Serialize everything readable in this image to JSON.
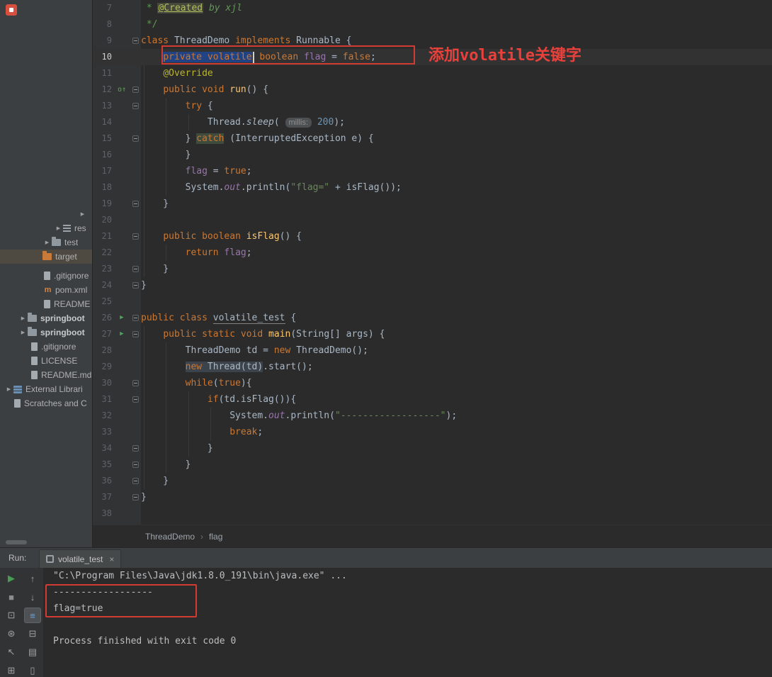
{
  "project_tree": {
    "items": [
      {
        "indent": 110,
        "arrow": true,
        "icon": "",
        "label": "",
        "bold": false,
        "selected": false
      },
      {
        "indent": 76,
        "arrow": true,
        "icon": "list",
        "label": "res",
        "bold": false,
        "selected": false
      },
      {
        "indent": 60,
        "arrow": true,
        "icon": "folder",
        "label": "test",
        "bold": false,
        "selected": false
      },
      {
        "indent": 60,
        "arrow": false,
        "icon": "folder-ex",
        "label": "target",
        "bold": false,
        "selected": true
      },
      {
        "indent": 62,
        "arrow": false,
        "icon": "file",
        "label": ".gitignore",
        "bold": false,
        "selected": false
      },
      {
        "indent": 62,
        "arrow": false,
        "icon": "maven",
        "label": "pom.xml",
        "bold": false,
        "selected": false
      },
      {
        "indent": 62,
        "arrow": false,
        "icon": "file",
        "label": "README",
        "bold": false,
        "selected": false
      },
      {
        "indent": 26,
        "arrow": true,
        "icon": "folder",
        "label": "springboot",
        "bold": true,
        "selected": false
      },
      {
        "indent": 26,
        "arrow": true,
        "icon": "folder",
        "label": "springboot",
        "bold": true,
        "selected": false
      },
      {
        "indent": 44,
        "arrow": false,
        "icon": "file",
        "label": ".gitignore",
        "bold": false,
        "selected": false
      },
      {
        "indent": 44,
        "arrow": false,
        "icon": "file",
        "label": "LICENSE",
        "bold": false,
        "selected": false
      },
      {
        "indent": 44,
        "arrow": false,
        "icon": "file",
        "label": "README.md",
        "bold": false,
        "selected": false
      },
      {
        "indent": 6,
        "arrow": true,
        "icon": "lib",
        "label": "External Librari",
        "bold": false,
        "selected": false
      },
      {
        "indent": 20,
        "arrow": false,
        "icon": "file",
        "label": "Scratches and C",
        "bold": false,
        "selected": false
      }
    ]
  },
  "editor": {
    "annotation": "添加volatile关键字",
    "icons": {
      "override": "o↑",
      "run": "▶"
    },
    "breadcrumb": {
      "items": [
        "ThreadDemo",
        "flag"
      ],
      "separator": "›"
    },
    "lines": [
      {
        "n": 7,
        "tokens": [
          [
            " * ",
            "c"
          ],
          [
            "@Created",
            "tag"
          ],
          [
            " ",
            "c"
          ],
          [
            "by xjl",
            "ci"
          ]
        ]
      },
      {
        "n": 8,
        "tokens": [
          [
            " */",
            "c"
          ]
        ]
      },
      {
        "n": 9,
        "fold": true,
        "tokens": [
          [
            "class",
            "k"
          ],
          [
            " ThreadDemo ",
            "d"
          ],
          [
            "implements",
            "k"
          ],
          [
            " Runnable {",
            "d"
          ]
        ]
      },
      {
        "n": 10,
        "caret": true,
        "tokens": [
          [
            "    ",
            "d"
          ],
          [
            "private volatile",
            "ksel"
          ],
          [
            "",
            "cur"
          ],
          [
            " ",
            "d"
          ],
          [
            "boolean",
            "k"
          ],
          [
            " ",
            "d"
          ],
          [
            "flag",
            "f"
          ],
          [
            " = ",
            "d"
          ],
          [
            "false",
            "k"
          ],
          [
            ";",
            "d"
          ]
        ]
      },
      {
        "n": 11,
        "tokens": [
          [
            "    ",
            "d"
          ],
          [
            "@Override",
            "a"
          ]
        ]
      },
      {
        "n": 12,
        "fold": true,
        "marker": "override",
        "tokens": [
          [
            "    ",
            "d"
          ],
          [
            "public",
            "k"
          ],
          [
            " ",
            "d"
          ],
          [
            "void",
            "k"
          ],
          [
            " ",
            "d"
          ],
          [
            "run",
            "m"
          ],
          [
            "() {",
            "d"
          ]
        ]
      },
      {
        "n": 13,
        "fold": true,
        "tokens": [
          [
            "        ",
            "d"
          ],
          [
            "try",
            "k"
          ],
          [
            " {",
            "d"
          ]
        ]
      },
      {
        "n": 14,
        "tokens": [
          [
            "            Thread.",
            "d"
          ],
          [
            "sleep",
            "it"
          ],
          [
            "( ",
            "d"
          ],
          [
            "millis:",
            "hint"
          ],
          [
            " ",
            "d"
          ],
          [
            "200",
            "n"
          ],
          [
            ");",
            "d"
          ]
        ]
      },
      {
        "n": 15,
        "fold": true,
        "tokens": [
          [
            "        } ",
            "d"
          ],
          [
            "catch",
            "khl"
          ],
          [
            " (InterruptedException e) {",
            "d"
          ]
        ]
      },
      {
        "n": 16,
        "tokens": [
          [
            "        }",
            "d"
          ]
        ]
      },
      {
        "n": 17,
        "tokens": [
          [
            "        ",
            "d"
          ],
          [
            "flag",
            "f"
          ],
          [
            " = ",
            "d"
          ],
          [
            "true",
            "k"
          ],
          [
            ";",
            "d"
          ]
        ]
      },
      {
        "n": 18,
        "tokens": [
          [
            "        System.",
            "d"
          ],
          [
            "out",
            "fi"
          ],
          [
            ".println(",
            "d"
          ],
          [
            "\"flag=\"",
            "s"
          ],
          [
            " + isFlag());",
            "d"
          ]
        ]
      },
      {
        "n": 19,
        "fold": true,
        "tokens": [
          [
            "    }",
            "d"
          ]
        ]
      },
      {
        "n": 20,
        "tokens": []
      },
      {
        "n": 21,
        "fold": true,
        "tokens": [
          [
            "    ",
            "d"
          ],
          [
            "public",
            "k"
          ],
          [
            " ",
            "d"
          ],
          [
            "boolean",
            "k"
          ],
          [
            " ",
            "d"
          ],
          [
            "isFlag",
            "m"
          ],
          [
            "() {",
            "d"
          ]
        ]
      },
      {
        "n": 22,
        "tokens": [
          [
            "        ",
            "d"
          ],
          [
            "return",
            "k"
          ],
          [
            " ",
            "d"
          ],
          [
            "flag",
            "f"
          ],
          [
            ";",
            "d"
          ]
        ]
      },
      {
        "n": 23,
        "fold": true,
        "tokens": [
          [
            "    }",
            "d"
          ]
        ]
      },
      {
        "n": 24,
        "fold": true,
        "tokens": [
          [
            "}",
            "d"
          ]
        ]
      },
      {
        "n": 25,
        "tokens": []
      },
      {
        "n": 26,
        "fold": true,
        "marker": "run",
        "tokens": [
          [
            "public",
            "k"
          ],
          [
            " ",
            "d"
          ],
          [
            "class",
            "k"
          ],
          [
            " ",
            "d"
          ],
          [
            "volatile_test",
            "u"
          ],
          [
            " {",
            "d"
          ]
        ]
      },
      {
        "n": 27,
        "fold": true,
        "marker": "run",
        "tokens": [
          [
            "    ",
            "d"
          ],
          [
            "public",
            "k"
          ],
          [
            " ",
            "d"
          ],
          [
            "static",
            "k"
          ],
          [
            " ",
            "d"
          ],
          [
            "void",
            "k"
          ],
          [
            " ",
            "d"
          ],
          [
            "main",
            "m"
          ],
          [
            "(String[] args) {",
            "d"
          ]
        ]
      },
      {
        "n": 28,
        "tokens": [
          [
            "        ThreadDemo td = ",
            "d"
          ],
          [
            "new",
            "k"
          ],
          [
            " ThreadDemo();",
            "d"
          ]
        ]
      },
      {
        "n": 29,
        "tokens": [
          [
            "        ",
            "d"
          ],
          [
            "new",
            "khl2"
          ],
          [
            " Thread(td)",
            "dhl2"
          ],
          [
            ".start();",
            "d"
          ]
        ]
      },
      {
        "n": 30,
        "fold": true,
        "tokens": [
          [
            "        ",
            "d"
          ],
          [
            "while",
            "k"
          ],
          [
            "(",
            "d"
          ],
          [
            "true",
            "k"
          ],
          [
            "){",
            "d"
          ]
        ]
      },
      {
        "n": 31,
        "fold": true,
        "tokens": [
          [
            "            ",
            "d"
          ],
          [
            "if",
            "k"
          ],
          [
            "(td.isFlag()){",
            "d"
          ]
        ]
      },
      {
        "n": 32,
        "tokens": [
          [
            "                System.",
            "d"
          ],
          [
            "out",
            "fi"
          ],
          [
            ".println(",
            "d"
          ],
          [
            "\"------------------\"",
            "s"
          ],
          [
            ");",
            "d"
          ]
        ]
      },
      {
        "n": 33,
        "tokens": [
          [
            "                ",
            "d"
          ],
          [
            "break",
            "k"
          ],
          [
            ";",
            "d"
          ]
        ]
      },
      {
        "n": 34,
        "fold": true,
        "tokens": [
          [
            "            }",
            "d"
          ]
        ]
      },
      {
        "n": 35,
        "fold": true,
        "tokens": [
          [
            "        }",
            "d"
          ]
        ]
      },
      {
        "n": 36,
        "fold": true,
        "tokens": [
          [
            "    }",
            "d"
          ]
        ]
      },
      {
        "n": 37,
        "fold": true,
        "tokens": [
          [
            "}",
            "d"
          ]
        ]
      },
      {
        "n": 38,
        "tokens": []
      }
    ]
  },
  "run_panel": {
    "label": "Run:",
    "tab": {
      "title": "volatile_test",
      "close": "×"
    },
    "toolbar_col1": [
      {
        "name": "rerun",
        "glyph": "▶",
        "color": "#499c54",
        "selected": false
      },
      {
        "name": "stop",
        "glyph": "■",
        "color": "#8c8c8c",
        "selected": false
      },
      {
        "name": "screenshot",
        "glyph": "⊡",
        "color": "#9da0a2",
        "selected": false
      },
      {
        "name": "settings",
        "glyph": "⊛",
        "color": "#9da0a2",
        "selected": false
      },
      {
        "name": "restore-layout",
        "glyph": "↖",
        "color": "#9da0a2",
        "selected": false
      },
      {
        "name": "pin-grid",
        "glyph": "⊞",
        "color": "#9da0a2",
        "selected": false
      }
    ],
    "toolbar_col2": [
      {
        "name": "up",
        "glyph": "↑",
        "color": "#9da0a2",
        "selected": false
      },
      {
        "name": "down",
        "glyph": "↓",
        "color": "#9da0a2",
        "selected": false
      },
      {
        "name": "console-view",
        "glyph": "≡",
        "color": "#6aa0d8",
        "selected": true
      },
      {
        "name": "soft-wrap",
        "glyph": "⊟",
        "color": "#9da0a2",
        "selected": false
      },
      {
        "name": "print",
        "glyph": "▤",
        "color": "#9da0a2",
        "selected": false
      },
      {
        "name": "clear",
        "glyph": "▯",
        "color": "#9da0a2",
        "selected": false
      }
    ],
    "console": {
      "lines": [
        "\"C:\\Program Files\\Java\\jdk1.8.0_191\\bin\\java.exe\" ...",
        "------------------",
        "flag=true",
        "",
        "Process finished with exit code 0"
      ]
    }
  }
}
